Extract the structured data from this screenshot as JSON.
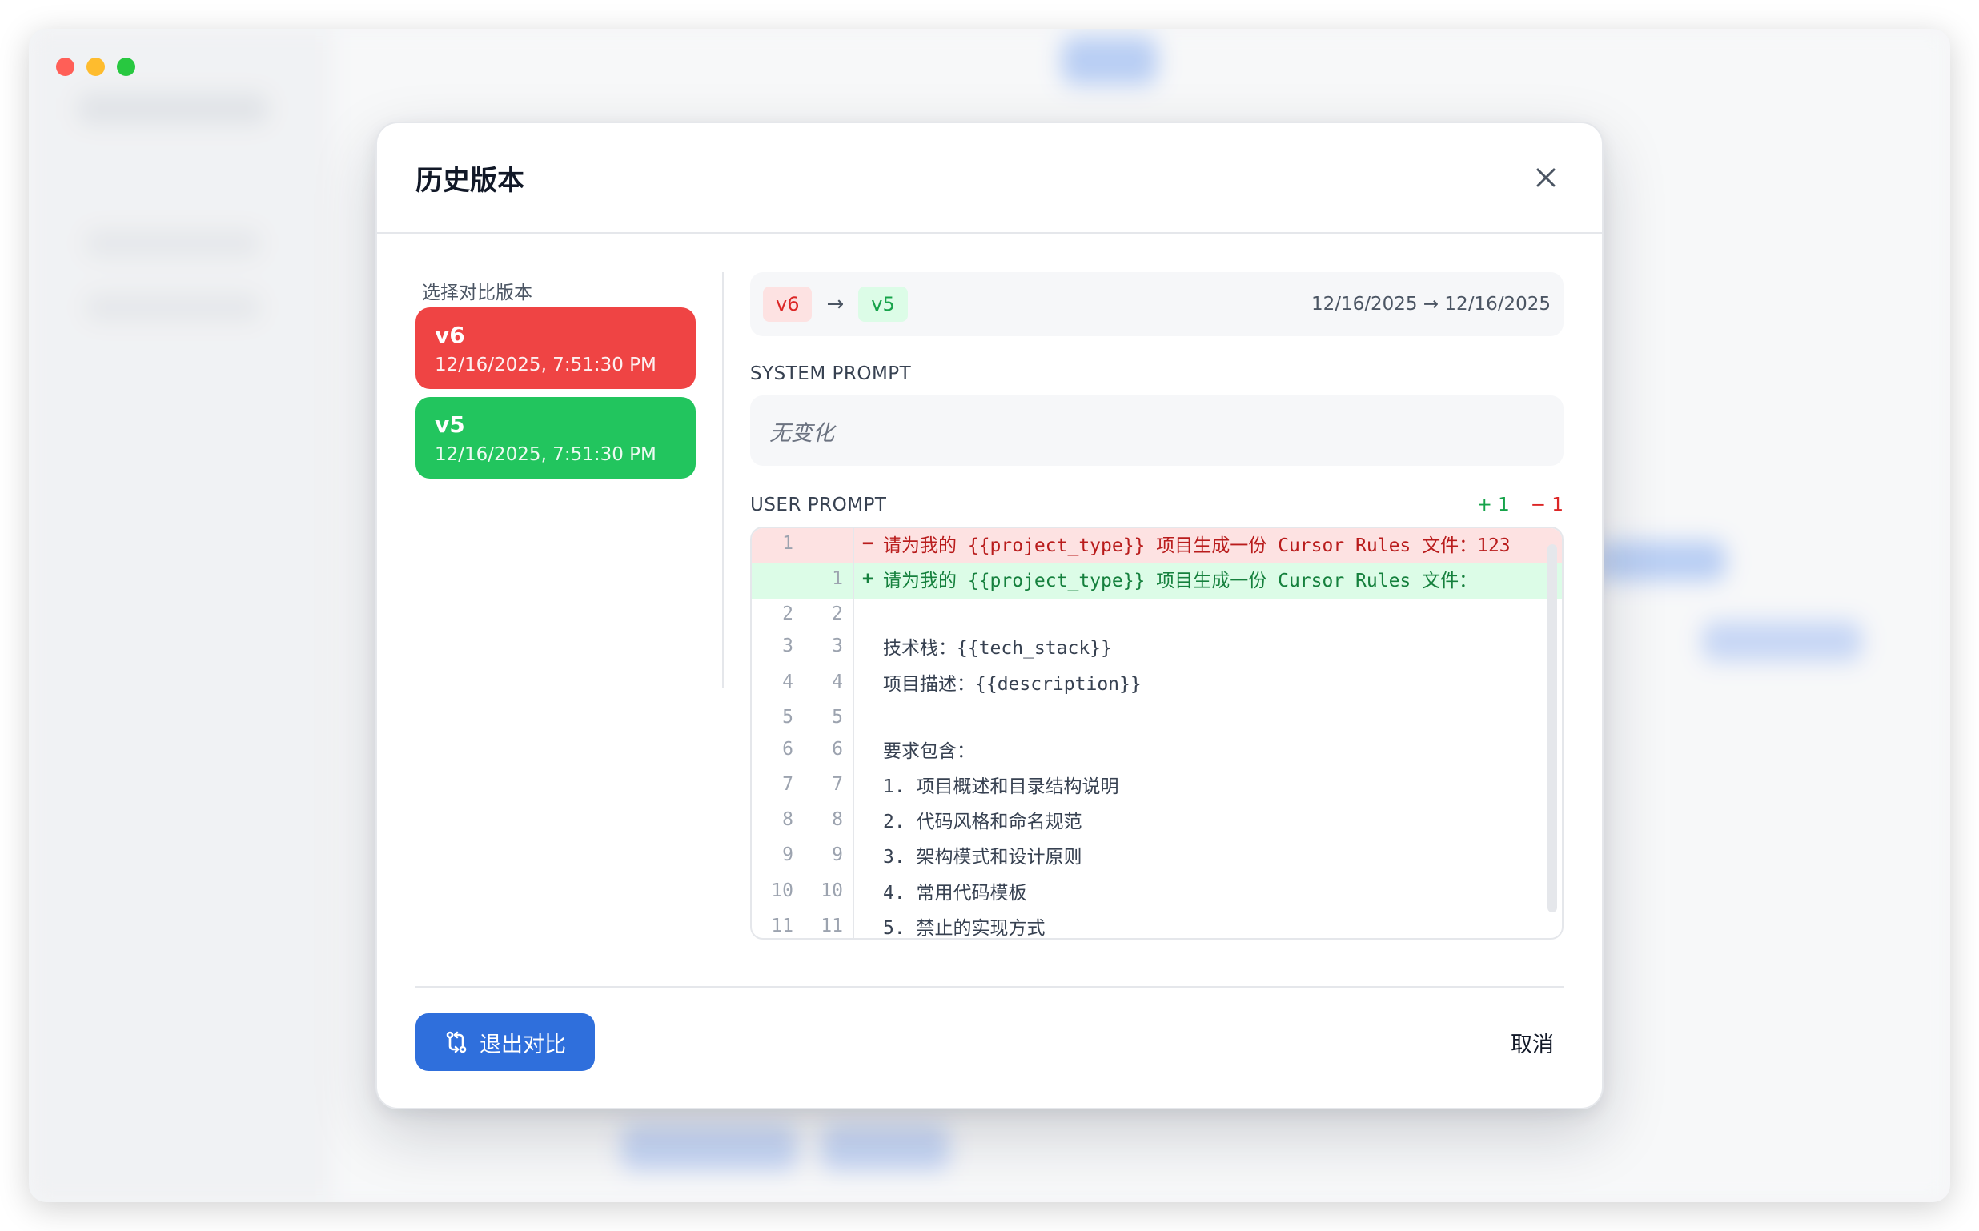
{
  "modal": {
    "title": "历史版本",
    "select_label": "选择对比版本",
    "versions": [
      {
        "label": "v6",
        "date": "12/16/2025, 7:51:30 PM",
        "color": "#ef4444"
      },
      {
        "label": "v5",
        "date": "12/16/2025, 7:51:30 PM",
        "color": "#22c55e"
      }
    ],
    "compare": {
      "from": "v6",
      "to": "v5",
      "arrow": "→",
      "dates": "12/16/2025 → 12/16/2025"
    },
    "system_prompt": {
      "label": "SYSTEM PROMPT",
      "status": "无变化"
    },
    "user_prompt": {
      "label": "USER PROMPT",
      "added": "+ 1",
      "removed": "− 1",
      "lines": [
        {
          "type": "del",
          "old": "1",
          "new": "",
          "sign": "−",
          "text": "请为我的 {{project_type}} 项目生成一份 Cursor Rules 文件：123"
        },
        {
          "type": "add",
          "old": "",
          "new": "1",
          "sign": "+",
          "text": "请为我的 {{project_type}} 项目生成一份 Cursor Rules 文件："
        },
        {
          "type": "ctx",
          "old": "2",
          "new": "2",
          "sign": "",
          "text": ""
        },
        {
          "type": "ctx",
          "old": "3",
          "new": "3",
          "sign": "",
          "text": "技术栈：{{tech_stack}}"
        },
        {
          "type": "ctx",
          "old": "4",
          "new": "4",
          "sign": "",
          "text": "项目描述：{{description}}"
        },
        {
          "type": "ctx",
          "old": "5",
          "new": "5",
          "sign": "",
          "text": ""
        },
        {
          "type": "ctx",
          "old": "6",
          "new": "6",
          "sign": "",
          "text": "要求包含："
        },
        {
          "type": "ctx",
          "old": "7",
          "new": "7",
          "sign": "",
          "text": "1. 项目概述和目录结构说明"
        },
        {
          "type": "ctx",
          "old": "8",
          "new": "8",
          "sign": "",
          "text": "2. 代码风格和命名规范"
        },
        {
          "type": "ctx",
          "old": "9",
          "new": "9",
          "sign": "",
          "text": "3. 架构模式和设计原则"
        },
        {
          "type": "ctx",
          "old": "10",
          "new": "10",
          "sign": "",
          "text": "4. 常用代码模板"
        },
        {
          "type": "ctx",
          "old": "11",
          "new": "11",
          "sign": "",
          "text": "5. 禁止的实现方式"
        }
      ]
    },
    "buttons": {
      "exit_compare": "退出对比",
      "cancel": "取消"
    }
  },
  "colors": {
    "primary": "#2f6fdc",
    "added": "#16a34a",
    "removed": "#dc2626"
  },
  "icons": [
    "close-icon",
    "compare-icon"
  ]
}
